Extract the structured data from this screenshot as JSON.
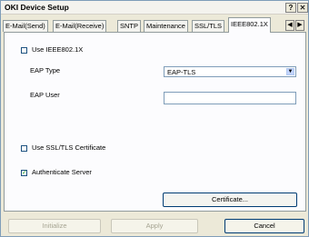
{
  "window": {
    "title": "OKI Device Setup"
  },
  "titlebar": {
    "help_glyph": "?",
    "close_glyph": "✕"
  },
  "tabs": [
    {
      "label": "E-Mail(Send)"
    },
    {
      "label": "E-Mail(Receive)"
    },
    {
      "label": "SNTP"
    },
    {
      "label": "Maintenance"
    },
    {
      "label": "SSL/TLS"
    },
    {
      "label": "IEEE802.1X"
    }
  ],
  "tab_scroll": {
    "left": "◀",
    "right": "▶"
  },
  "panel": {
    "use_ieee": {
      "label": "Use IEEE802.1X",
      "checked": false
    },
    "eap_type": {
      "label": "EAP Type",
      "value": "EAP-TLS"
    },
    "eap_user": {
      "label": "EAP User",
      "value": ""
    },
    "use_ssl_cert": {
      "label": "Use SSL/TLS Certificate",
      "checked": false
    },
    "auth_server": {
      "label": "Authenticate Server",
      "checked": true,
      "mark": "✓"
    },
    "certificate_button": "Certificate..."
  },
  "footer": {
    "initialize": "Initialize",
    "apply": "Apply",
    "cancel": "Cancel"
  },
  "icons": {
    "dropdown": "chevron-down-icon"
  }
}
